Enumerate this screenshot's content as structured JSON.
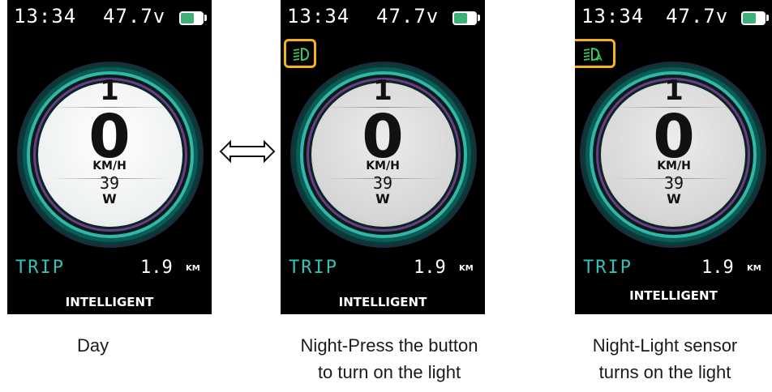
{
  "screens": [
    {
      "id": "day",
      "time": "13:34",
      "voltage": "47.7v",
      "battery_level": 0.6,
      "gear": "1",
      "speed": "0",
      "speed_unit": "KM/H",
      "power": "39",
      "power_unit": "W",
      "trip_label": "TRIP",
      "trip_value": "1.9",
      "trip_unit": "KM",
      "mode": "INTELLIGENT",
      "light_icon": null,
      "caption_lines": [
        "Day"
      ]
    },
    {
      "id": "night-manual",
      "time": "13:34",
      "voltage": "47.7v",
      "battery_level": 0.6,
      "gear": "1",
      "speed": "0",
      "speed_unit": "KM/H",
      "power": "39",
      "power_unit": "W",
      "trip_label": "TRIP",
      "trip_value": "1.9",
      "trip_unit": "KM",
      "mode": "INTELLIGENT",
      "light_icon": "headlight-icon",
      "caption_lines": [
        "Night-Press the button",
        "to turn on the light"
      ]
    },
    {
      "id": "night-auto",
      "time": "13:34",
      "voltage": "47.7v",
      "battery_level": 0.6,
      "gear": "1",
      "speed": "0",
      "speed_unit": "KM/H",
      "power": "39",
      "power_unit": "W",
      "trip_label": "TRIP",
      "trip_value": "1.9",
      "trip_unit": "KM",
      "mode": "INTELLIGENT",
      "light_icon": "auto-headlight-icon",
      "caption_lines": [
        "Night-Light sensor",
        "turns on the light"
      ]
    }
  ],
  "colors": {
    "accent_teal": "#35c2b4",
    "battery_green": "#3faf7a",
    "highlight_orange": "#f4b21e"
  },
  "connector_icon": "double-arrow-icon"
}
